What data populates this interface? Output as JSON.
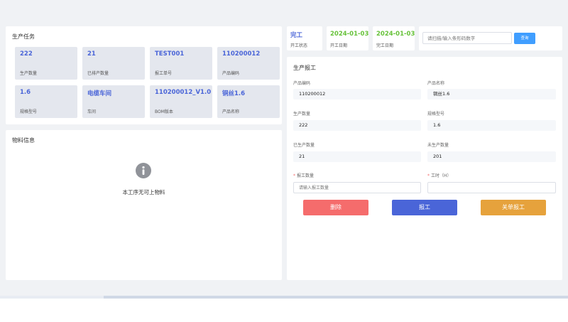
{
  "task_panel": {
    "title": "生产任务",
    "cards": [
      {
        "value": "222",
        "label": "生产数量"
      },
      {
        "value": "21",
        "label": "已排产数量"
      },
      {
        "value": "TEST001",
        "label": "报工单号"
      },
      {
        "value": "110200012",
        "label": "产品编码"
      },
      {
        "value": "1.6",
        "label": "规格型号"
      },
      {
        "value": "电缆车间",
        "label": "车间"
      },
      {
        "value": "110200012_V1.0",
        "label": "BOM版本"
      },
      {
        "value": "铜丝1.6",
        "label": "产品名称"
      }
    ]
  },
  "material_panel": {
    "title": "物料信息",
    "empty_text": "本工序无可上物料"
  },
  "status_cards": [
    {
      "value": "完工",
      "label": "开工状态",
      "color": "#4a65d8"
    },
    {
      "value": "2024-01-03",
      "label": "开工日期",
      "color": "#67c23a"
    },
    {
      "value": "2024-01-03",
      "label": "完工日期",
      "color": "#67c23a"
    }
  ],
  "scan": {
    "placeholder": "请扫描/输入条形码数字",
    "button": "查询"
  },
  "report_panel": {
    "title": "生产报工",
    "fields": {
      "product_code": {
        "label": "产品编码",
        "value": "110200012"
      },
      "product_name": {
        "label": "产品名称",
        "value": "铜丝1.6"
      },
      "production_qty": {
        "label": "生产数量",
        "value": "222"
      },
      "spec": {
        "label": "规格型号",
        "value": "1.6"
      },
      "produced_qty": {
        "label": "已生产数量",
        "value": "21"
      },
      "pending_qty": {
        "label": "未生产数量",
        "value": "201"
      }
    },
    "report_qty": {
      "label": "报工数量",
      "placeholder": "请输入报工数量"
    },
    "work_hours": {
      "label": "工时（H）",
      "placeholder": ""
    },
    "buttons": {
      "delete": "删除",
      "report": "报工",
      "close": "关单报工"
    }
  },
  "colors": {
    "accent": "#4a65d8",
    "success": "#67c23a",
    "danger": "#f56c6c",
    "warning": "#e6a23c",
    "primary_button": "#409eff",
    "card_bg": "#e4e7ee"
  }
}
